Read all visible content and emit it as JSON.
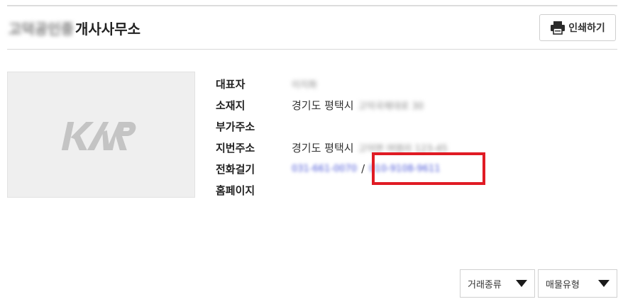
{
  "header": {
    "office_name_blurred": "고덕공인중",
    "office_name_suffix": "개사사무소",
    "print_label": "인쇄하기",
    "print_icon": "printer-icon"
  },
  "logo": {
    "icon": "kar-logo",
    "text": "KAR"
  },
  "info": {
    "rows": [
      {
        "label": "대표자",
        "value": "",
        "blurred": "이지화"
      },
      {
        "label": "소재지",
        "value": "경기도 평택시",
        "blurred": "고덕국제대로 30"
      },
      {
        "label": "부가주소",
        "value": "",
        "blurred": ""
      },
      {
        "label": "지번주소",
        "value": "경기도 평택시",
        "blurred": "고덕면 여염리 123-45"
      },
      {
        "label": "전화걸기",
        "value": "",
        "blurred": ""
      },
      {
        "label": "홈페이지",
        "value": "",
        "blurred": ""
      }
    ],
    "phone_primary": "031-661-0070",
    "phone_separator": "/",
    "phone_mobile": "010-9108-9611"
  },
  "highlight_color": "#e01b24",
  "filters": {
    "deal_type": "거래종류",
    "property_type": "매물유형"
  }
}
